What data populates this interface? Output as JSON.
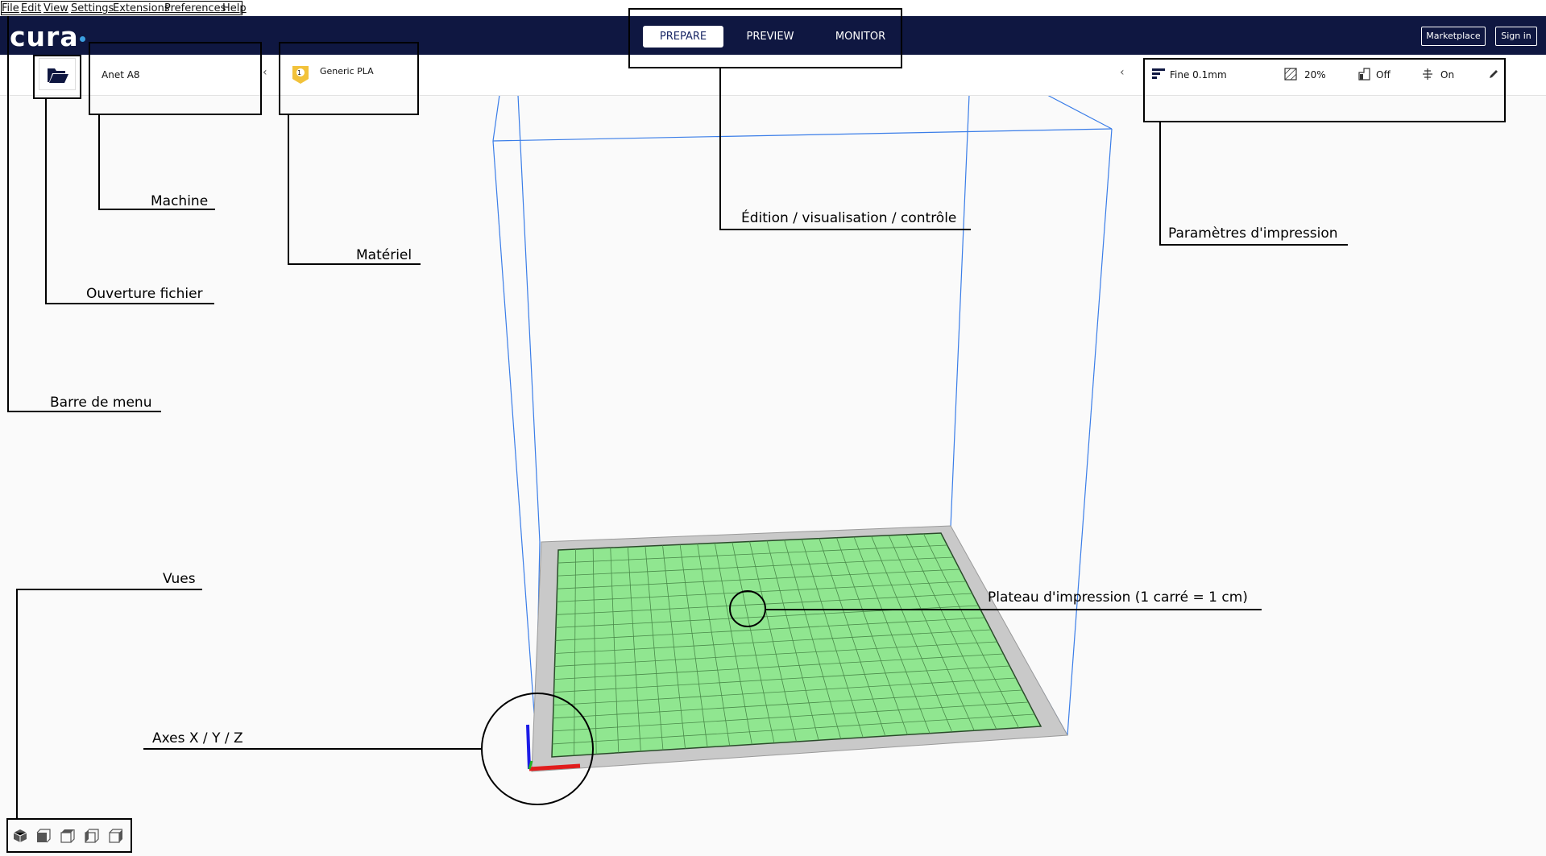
{
  "menubar": {
    "items": [
      "File",
      "Edit",
      "View",
      "Settings",
      "Extensions",
      "Preferences",
      "Help"
    ]
  },
  "header": {
    "logo": "cura",
    "stages": [
      "PREPARE",
      "PREVIEW",
      "MONITOR"
    ],
    "marketplace": "Marketplace",
    "sign_in": "Sign in"
  },
  "toolbar": {
    "machine": "Anet A8",
    "material_badge": "1",
    "material": "Generic PLA",
    "profile": "Fine 0.1mm",
    "infill": "20%",
    "support": "Off",
    "adhesion": "On"
  },
  "annotations": {
    "menu_bar": "Barre de menu",
    "open_file": "Ouverture fichier",
    "machine": "Machine",
    "material": "Matériel",
    "stages": "Édition / visualisation / contrôle",
    "print_settings": "Paramètres d'impression",
    "build_plate": "Plateau d'impression (1 carré = 1 cm)",
    "views": "Vues",
    "axes": "Axes X / Y / Z"
  },
  "colors": {
    "header_bg": "#0f1741",
    "plate_green": "#90e690",
    "volume_blue": "#3a7de8",
    "axis_x": "#e11c1c",
    "axis_y": "#21b521",
    "axis_z": "#1c1ce6"
  }
}
